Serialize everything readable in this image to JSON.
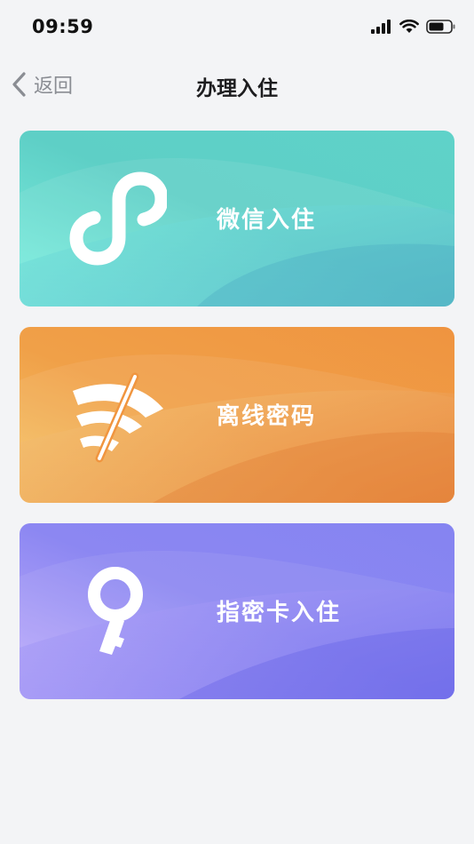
{
  "status_bar": {
    "time": "09:59",
    "icons": [
      "signal-icon",
      "wifi-icon",
      "battery-icon"
    ]
  },
  "nav": {
    "back_label": "返回",
    "title": "办理入住"
  },
  "cards": [
    {
      "label": "微信入住",
      "icon": "mini-program-icon",
      "colors": [
        "#7ef0e0",
        "#5ecfc6",
        "#4fb0c8"
      ]
    },
    {
      "label": "离线密码",
      "icon": "offline-wifi-icon",
      "colors": [
        "#f6c76a",
        "#f0953f",
        "#e57a34"
      ]
    },
    {
      "label": "指密卡入住",
      "icon": "key-icon",
      "colors": [
        "#c2b0fb",
        "#8c87f2",
        "#6866ea"
      ]
    }
  ]
}
